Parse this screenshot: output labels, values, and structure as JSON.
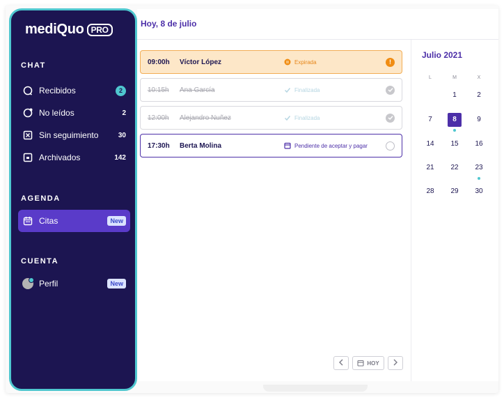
{
  "app": {
    "logo_text": "mediQuo",
    "logo_badge": "PRO"
  },
  "sidebar": {
    "chat_title": "CHAT",
    "chat_items": [
      {
        "label": "Recibidos",
        "count": "2",
        "icon": "chat-bubble-icon"
      },
      {
        "label": "No leídos",
        "count": "2",
        "icon": "unread-bubble-icon"
      },
      {
        "label": "Sin seguimiento",
        "count": "30",
        "icon": "no-followup-icon"
      },
      {
        "label": "Archivados",
        "count": "142",
        "icon": "archive-icon"
      }
    ],
    "agenda_title": "AGENDA",
    "agenda_item": {
      "label": "Citas",
      "badge": "New",
      "icon": "calendar-icon"
    },
    "account_title": "CUENTA",
    "account_item": {
      "label": "Perfil",
      "badge": "New",
      "icon": "avatar"
    }
  },
  "header": {
    "title": "Hoy, 8 de julio"
  },
  "appointments": [
    {
      "time": "09:00h",
      "name": "Víctor López",
      "status": "Expirada",
      "state": "expired"
    },
    {
      "time": "10:15h",
      "name": "Ana García",
      "status": "Finalizada",
      "state": "done"
    },
    {
      "time": "12:00h",
      "name": "Alejandro Nuñez",
      "status": "Finalizada",
      "state": "done"
    },
    {
      "time": "17:30h",
      "name": "Berta Molina",
      "status": "Pendiente de aceptar y pagar",
      "state": "pending"
    }
  ],
  "pager": {
    "today_label": "HOY"
  },
  "calendar": {
    "title": "Julio 2021",
    "weekdays": [
      "L",
      "M",
      "X"
    ],
    "rows": [
      [
        "",
        "1",
        "2"
      ],
      [
        "7",
        "8",
        "9"
      ],
      [
        "14",
        "15",
        "16"
      ],
      [
        "21",
        "22",
        "23"
      ],
      [
        "28",
        "29",
        "30"
      ]
    ],
    "selected_day": "8",
    "days_with_events": [
      "8",
      "23"
    ]
  },
  "colors": {
    "sidebar_bg": "#1c1551",
    "accent": "#4c2fa8",
    "teal": "#4fc7cf",
    "expired_bg": "#fde7c8",
    "expired_accent": "#f08c12"
  }
}
